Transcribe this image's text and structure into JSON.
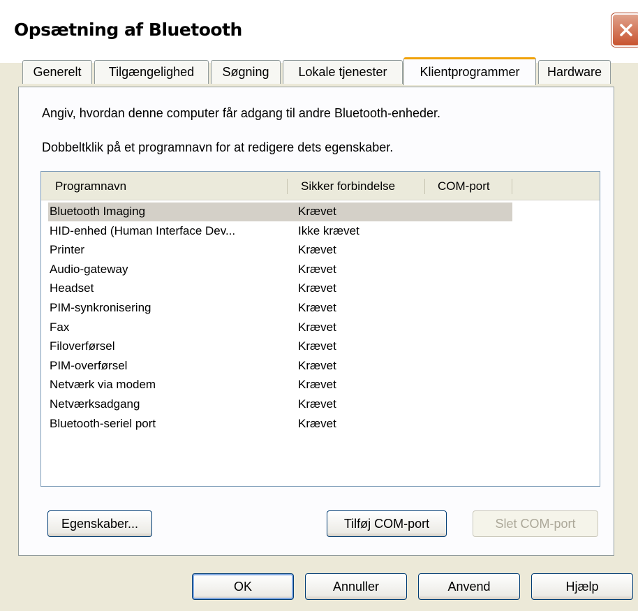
{
  "window": {
    "title": "Opsætning af Bluetooth",
    "close_icon": "close-x-icon"
  },
  "tabs": [
    {
      "label": "Generelt",
      "active": false
    },
    {
      "label": "Tilgængelighed",
      "active": false
    },
    {
      "label": "Søgning",
      "active": false
    },
    {
      "label": "Lokale tjenester",
      "active": false
    },
    {
      "label": "Klientprogrammer",
      "active": true
    },
    {
      "label": "Hardware",
      "active": false
    }
  ],
  "panel": {
    "description1": "Angiv, hvordan denne computer får adgang til andre Bluetooth-enheder.",
    "description2": "Dobbeltklik på et programnavn for at redigere dets egenskaber."
  },
  "listview": {
    "columns": [
      "Programnavn",
      "Sikker forbindelse",
      "COM-port"
    ],
    "rows": [
      {
        "name": "Bluetooth Imaging",
        "secure": "Krævet",
        "port": "",
        "selected": true
      },
      {
        "name": "HID-enhed (Human Interface Dev...",
        "secure": "Ikke krævet",
        "port": ""
      },
      {
        "name": "Printer",
        "secure": "Krævet",
        "port": ""
      },
      {
        "name": "Audio-gateway",
        "secure": "Krævet",
        "port": ""
      },
      {
        "name": "Headset",
        "secure": "Krævet",
        "port": ""
      },
      {
        "name": "PIM-synkronisering",
        "secure": "Krævet",
        "port": ""
      },
      {
        "name": "Fax",
        "secure": "Krævet",
        "port": ""
      },
      {
        "name": "Filoverførsel",
        "secure": "Krævet",
        "port": ""
      },
      {
        "name": "PIM-overførsel",
        "secure": "Krævet",
        "port": ""
      },
      {
        "name": "Netværk via modem",
        "secure": "Krævet",
        "port": ""
      },
      {
        "name": "Netværksadgang",
        "secure": "Krævet",
        "port": ""
      },
      {
        "name": "Bluetooth-seriel port",
        "secure": "Krævet",
        "port": ""
      }
    ]
  },
  "buttons": {
    "properties": "Egenskaber...",
    "add_com": "Tilføj COM-port",
    "delete_com": "Slet COM-port",
    "ok": "OK",
    "cancel": "Annuller",
    "apply": "Anvend",
    "help": "Hjælp"
  }
}
